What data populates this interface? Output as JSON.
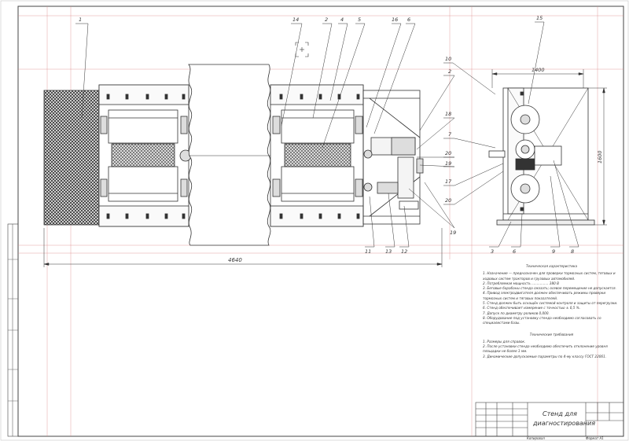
{
  "callouts": {
    "c1": "1",
    "c2": "2",
    "c3": "3",
    "c4": "4",
    "c5": "5",
    "c6": "6",
    "c7": "7",
    "c8": "8",
    "c9": "9",
    "c10": "10",
    "c11": "11",
    "c12": "12",
    "c13": "13",
    "c14": "14",
    "c15": "15",
    "c16": "16",
    "c17": "17",
    "c18": "18",
    "c19": "19",
    "c20": "20"
  },
  "dimensions": {
    "overall_length": "4640",
    "side_width": "1400",
    "side_height": "1600"
  },
  "tech": {
    "title": "Техническая характеристика",
    "items": [
      "1. Назначение — предназначен для проверки тормозных систем, тяговых и ходовых систем тракторов и грузовых автомобилей.",
      "2. Потребляемая мощность ................ 380 В",
      "3. Беговые барабаны стенда смазать; осевое перемещение не допускается.",
      "4. Привод электродвигателя должен обеспечивать режимы проверки тормозных систем и тяговых показателей.",
      "5. Стенд должен быть оснащён системой контроля и защиты от перегрузки.",
      "6. Стенд обеспечивает измерение с точностью ± 0,5 %.",
      "7. Допуск по диаметру роликов 0,000.",
      "8. Оборудование под установку стенда необходимо согласовать со специалистами базы."
    ],
    "req_title": "Технические требования",
    "requirements": [
      "1. Размеры для справок.",
      "2. После установки стенда необходимо обеспечить отклонение уровня площадки не более 1 мм.",
      "3. Динамические допускаемые параметры по 4-му классу ГОСТ 22061."
    ]
  },
  "title_block": {
    "name_line1": "Стенд для",
    "name_line2": "диагностирования",
    "sheet_text": "Копировал",
    "format_text": "Формат А1"
  }
}
